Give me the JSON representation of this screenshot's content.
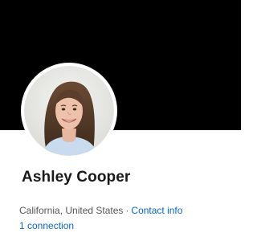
{
  "profile": {
    "name": "Ashley Cooper",
    "location": "California, United States",
    "separator": "·",
    "contact_info_label": "Contact info",
    "connections_label": "1 connection"
  },
  "colors": {
    "cover": "#000000",
    "link": "#0a66c2",
    "name": "#191919",
    "meta": "#555555"
  },
  "icons": {
    "avatar": "profile-photo"
  }
}
